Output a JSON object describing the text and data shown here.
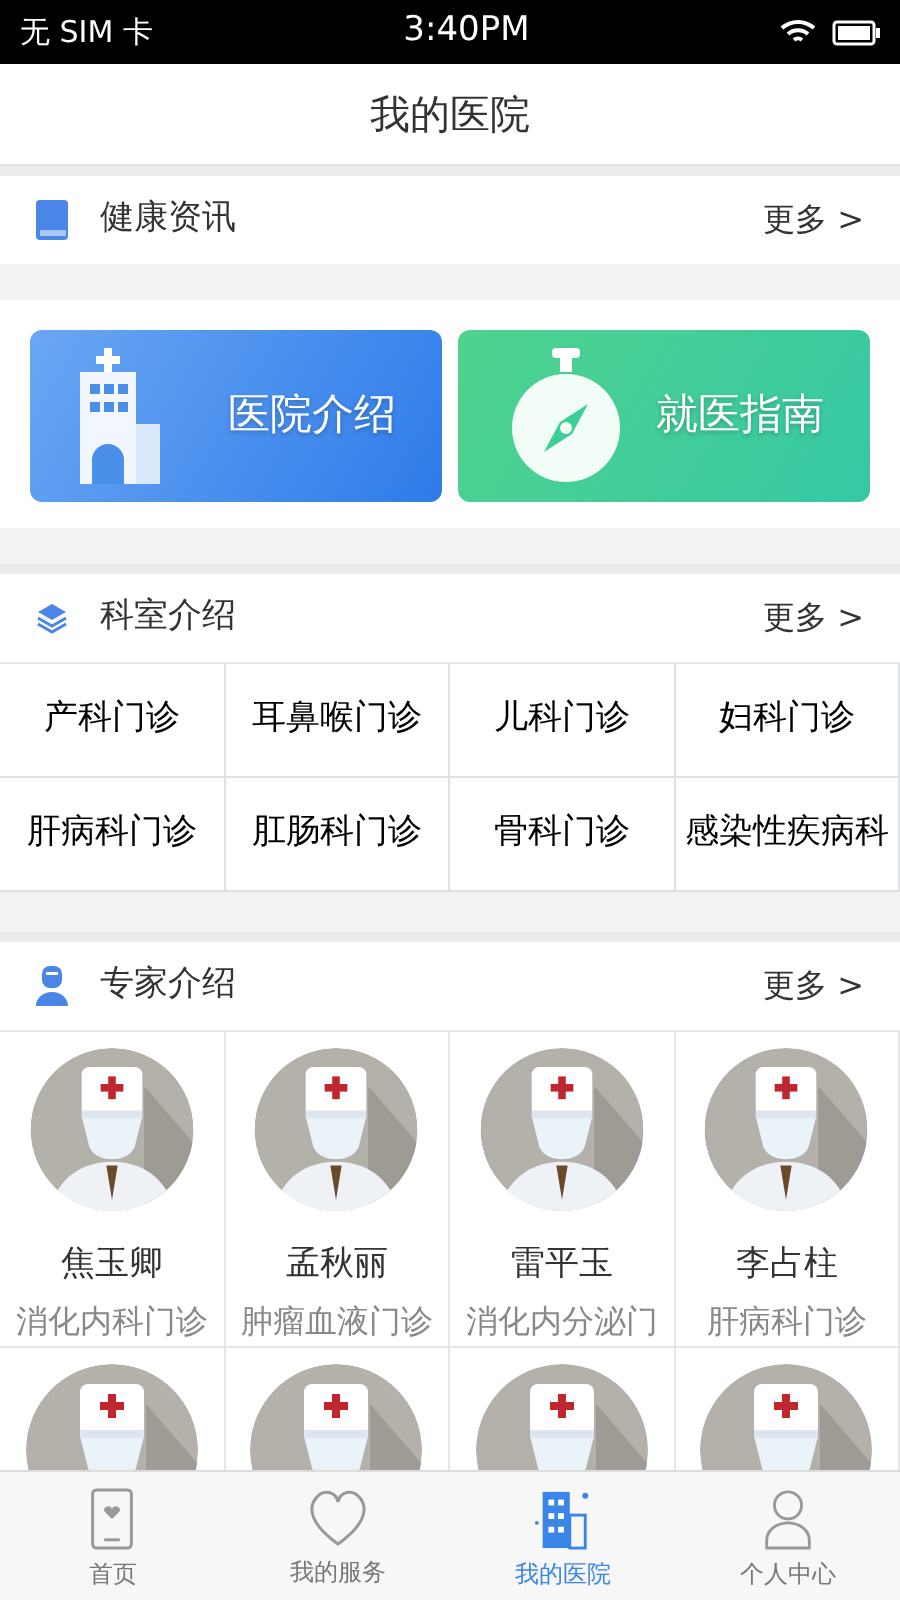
{
  "status_bar": {
    "carrier": "无 SIM 卡",
    "time": "3:40PM"
  },
  "title": "我的医院",
  "news": {
    "title": "健康资讯",
    "more": "更多 >"
  },
  "banners": [
    {
      "kind": "hospital",
      "label": "医院介绍"
    },
    {
      "kind": "guide",
      "label": "就医指南"
    }
  ],
  "departments": {
    "title": "科室介绍",
    "more": "更多 >",
    "items": [
      "产科门诊",
      "耳鼻喉门诊",
      "儿科门诊",
      "妇科门诊",
      "肝病科门诊",
      "肛肠科门诊",
      "骨科门诊",
      "感染性疾病科"
    ]
  },
  "experts": {
    "title": "专家介绍",
    "more": "更多 >",
    "items": [
      {
        "kind": "expert",
        "name": "焦玉卿",
        "dept": "消化内科门诊"
      },
      {
        "kind": "expert",
        "name": "孟秋丽",
        "dept": "肿瘤血液门诊"
      },
      {
        "kind": "expert",
        "name": "雷平玉",
        "dept": "消化内分泌门"
      },
      {
        "kind": "expert",
        "name": "李占柱",
        "dept": "肝病科门诊"
      },
      {
        "kind": "avatar"
      },
      {
        "kind": "avatar"
      },
      {
        "kind": "avatar"
      },
      {
        "kind": "avatar"
      }
    ]
  },
  "tab_bar": [
    {
      "kind": "home",
      "label": "首页",
      "selected": false
    },
    {
      "kind": "service",
      "label": "我的服务",
      "selected": false
    },
    {
      "kind": "hospital",
      "label": "我的医院",
      "selected": true
    },
    {
      "kind": "profile",
      "label": "个人中心",
      "selected": false
    }
  ]
}
